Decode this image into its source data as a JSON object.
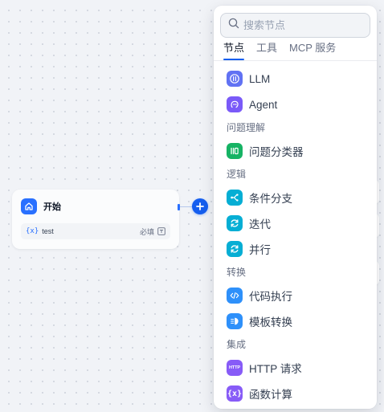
{
  "start_node": {
    "title": "开始",
    "variable": {
      "icon_text": "{x}",
      "name": "test",
      "required": "必填"
    }
  },
  "panel": {
    "search": {
      "placeholder": "搜索节点",
      "value": ""
    },
    "tabs": [
      {
        "label": "节点",
        "active": true
      },
      {
        "label": "工具",
        "active": false
      },
      {
        "label": "MCP 服务",
        "active": false
      }
    ],
    "items": {
      "llm": {
        "label": "LLM",
        "icon": "llm-icon",
        "color": "#6172f3"
      },
      "agent": {
        "label": "Agent",
        "icon": "agent-icon",
        "color": "#7a5af8"
      },
      "classifier": {
        "label": "问题分类器",
        "icon": "classifier-icon",
        "color": "#16b364"
      },
      "if_else": {
        "label": "条件分支",
        "icon": "branch-icon",
        "color": "#06aed4"
      },
      "iteration": {
        "label": "迭代",
        "icon": "iteration-icon",
        "color": "#06aed4"
      },
      "parallel": {
        "label": "并行",
        "icon": "loop-icon",
        "color": "#06aed4"
      },
      "code": {
        "label": "代码执行",
        "icon": "code-icon",
        "color": "#2e90fa"
      },
      "template": {
        "label": "模板转换",
        "icon": "template-icon",
        "color": "#2e90fa"
      },
      "http": {
        "label": "HTTP 请求",
        "icon": "http-icon",
        "icon_text": "HTTP",
        "color": "#875bf7"
      },
      "function": {
        "label": "函数计算",
        "icon": "function-icon",
        "icon_text": "{x}",
        "color": "#875bf7"
      }
    },
    "groups": {
      "understanding": "问题理解",
      "logic": "逻辑",
      "transform": "转换",
      "integration": "集成"
    }
  },
  "colors": {
    "accent": "#155eef",
    "start_icon": "#2970ff"
  }
}
